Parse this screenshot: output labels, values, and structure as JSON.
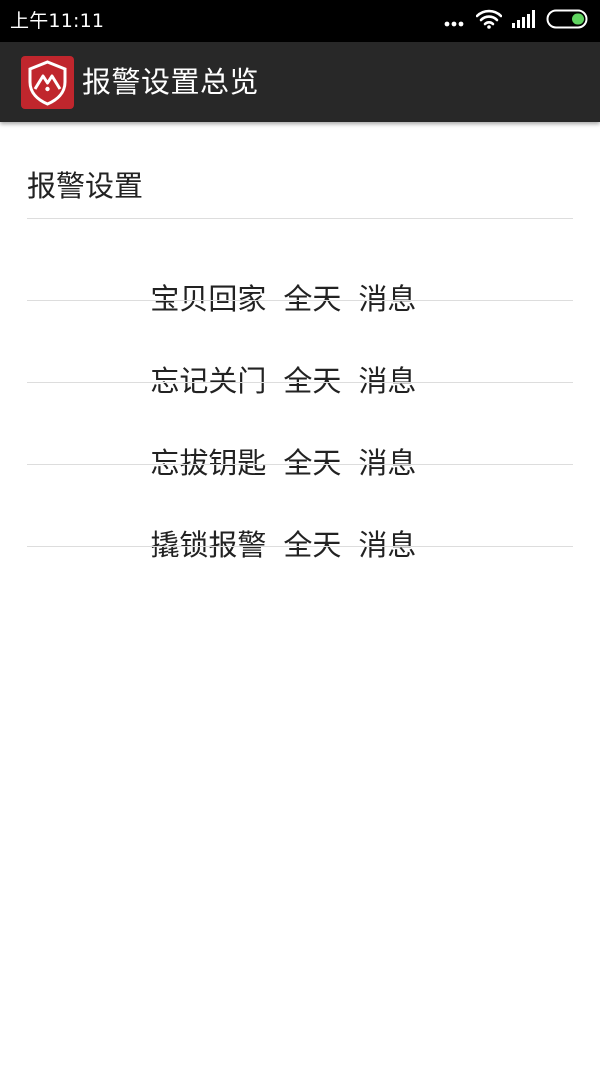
{
  "status_bar": {
    "time": "上午11:11",
    "battery_color": "#5fd35f"
  },
  "app_bar": {
    "title": "报警设置总览",
    "logo_color": "#c0262d"
  },
  "section": {
    "title": "报警设置"
  },
  "alarms": [
    {
      "name": "宝贝回家",
      "schedule": "全天",
      "mode": "消息"
    },
    {
      "name": "忘记关门",
      "schedule": "全天",
      "mode": "消息"
    },
    {
      "name": "忘拔钥匙",
      "schedule": "全天",
      "mode": "消息"
    },
    {
      "name": "撬锁报警",
      "schedule": "全天",
      "mode": "消息"
    }
  ]
}
